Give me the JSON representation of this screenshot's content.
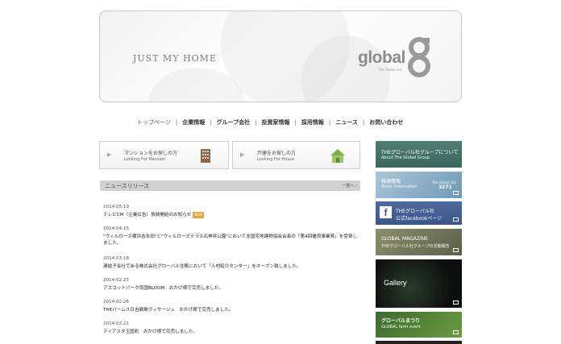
{
  "banner": {
    "tagline": "JUST MY HOME",
    "logo_word": "global",
    "logo_sub": "The Global Ltd."
  },
  "nav": [
    {
      "label": "トップページ"
    },
    {
      "label": "企業情報"
    },
    {
      "label": "グループ会社"
    },
    {
      "label": "投資家情報"
    },
    {
      "label": "採用情報"
    },
    {
      "label": "ニュース"
    },
    {
      "label": "お問い合わせ"
    }
  ],
  "search": {
    "mansion_jp": "マンションをお探しの方",
    "mansion_en": "Looking For Mansion",
    "house_jp": "戸建をお探しの方",
    "house_en": "Looking For House"
  },
  "news": {
    "header": "ニュースリリース",
    "more": "一覧へ ›",
    "new_badge": "NEW",
    "items": [
      {
        "date": "2014.05.19",
        "title": "テレビCM（企業広告）放映開始のお知らせ"
      },
      {
        "date": "2014.04.15",
        "title": "\"ウィルローズ横浜吉永田\"と\"ウィルローズテラス石神井公園\"において全国宅地建物協会会長の「第4回優良事業賞」を受賞しました。"
      },
      {
        "date": "2014.03.18",
        "title": "連結子会社である株式会社グローバル住販において「人材紹介センター」をオープン致しました。"
      },
      {
        "date": "2014.02.27",
        "title": "アスコットパーク両国BLOOM　おかげ様で完売しました。"
      },
      {
        "date": "2014.02.26",
        "title": "THEパームス日吉綱島ヴィサージュ　おかげ様で完売しました。"
      },
      {
        "date": "2014.02.21",
        "title": "ディアスタ王国彩　おかげ様で完売しました。"
      }
    ]
  },
  "side": {
    "about_jp": "THEグローバル社グループについて",
    "about_en": "About The Global Group",
    "stock_jp": "株価情報",
    "stock_en": "Stock Information",
    "stock_company": "The Global Ltd.",
    "stock_code": "3271",
    "fb_line1": "THEグローバル社",
    "fb_line2": "公式facebookページ",
    "mag_line1": "GLOBAL MAGAZINE",
    "mag_line2": "THEグローバル社グループの活動報告",
    "gallery": "Gallery",
    "fest_line1": "グローバルまつり",
    "fest_line2": "GLOBAL farm event"
  },
  "colors": {
    "about_bg": "#3a6860",
    "facebook_bg": "#39558b",
    "new_badge": "#e8a63a"
  }
}
